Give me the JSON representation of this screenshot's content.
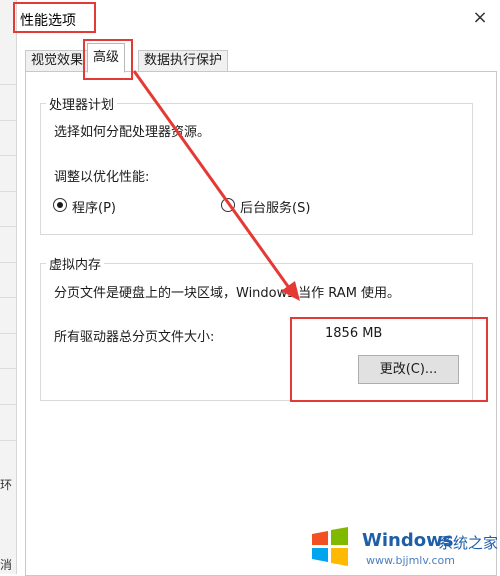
{
  "window": {
    "title": "性能选项",
    "close_symbol": "×"
  },
  "tabs": [
    {
      "label": "视觉效果",
      "active": false
    },
    {
      "label": "高级",
      "active": true
    },
    {
      "label": "数据执行保护",
      "active": false
    }
  ],
  "processor": {
    "group_label": "处理器计划",
    "description": "选择如何分配处理器资源。",
    "adjust_label": "调整以优化性能:",
    "options": [
      {
        "label": "程序(P)",
        "selected": true
      },
      {
        "label": "后台服务(S)",
        "selected": false
      }
    ]
  },
  "virtual_memory": {
    "group_label": "虚拟内存",
    "description": "分页文件是硬盘上的一块区域，Windows 当作 RAM 使用。",
    "total_label": "所有驱动器总分页文件大小:",
    "total_value": "1856 MB",
    "change_button": "更改(C)..."
  },
  "background_window": {
    "fragments": [
      "环",
      "消"
    ]
  },
  "watermark": {
    "brand": "Windows",
    "suffix": "系统之家",
    "url": "www.bjjmlv.com"
  },
  "colors": {
    "annotation_red": "#e53935",
    "accent_blue": "#1f5fa8"
  }
}
